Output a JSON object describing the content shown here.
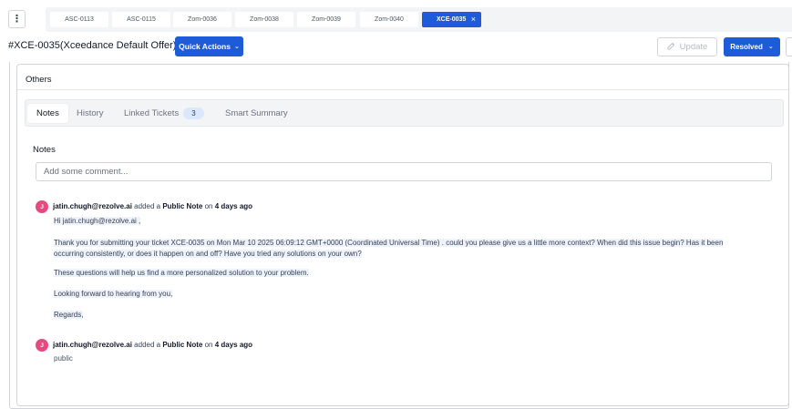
{
  "menu_icon": "vertical-dots-icon",
  "tabs": [
    {
      "label": "ASC-0113"
    },
    {
      "label": "ASC-0115"
    },
    {
      "label": "Zom-0036"
    },
    {
      "label": "Zom-0038"
    },
    {
      "label": "Zom-0039"
    },
    {
      "label": "Zom-0040"
    },
    {
      "label": "XCE-0035",
      "active": true,
      "close": "×"
    }
  ],
  "header": {
    "ticket_title": "#XCE-0035(Xceedance Default Offer)",
    "quick_actions": "Quick Actions",
    "update": "Update",
    "status": "Resolved"
  },
  "panel": {
    "section_title": "Others",
    "tabs": {
      "notes": "Notes",
      "history": "History",
      "linked": "Linked Tickets",
      "linked_count": "3",
      "summary": "Smart Summary"
    },
    "notes_heading": "Notes",
    "comment_placeholder": "Add some comment..."
  },
  "notes": [
    {
      "avatar": "J",
      "author": "jatin.chugh@rezolve.ai",
      "added": "added a",
      "type": "Public Note",
      "on": "on",
      "time": "4 days ago",
      "lines": {
        "greeting": "Hi jatin.chugh@rezolve.ai ,",
        "p1a": "Thank you for submitting your ticket XCE-0035  on Mon Mar 10 2025 06:09:12 GMT+0000 (Coordinated Universal Time) . could you please give us a little more context? When did this issue begin? Has it been",
        "p1b": "occurring consistently, or does it happen on and off? Have you tried any solutions on your own?",
        "p2": "These questions will help us find a more personalized solution to your problem.",
        "p3": "Looking forward to hearing from you,",
        "p4": "Regards,"
      }
    },
    {
      "avatar": "J",
      "author": "jatin.chugh@rezolve.ai",
      "added": "added a",
      "type": "Public Note",
      "on": "on",
      "time": "4 days ago",
      "body": "public"
    }
  ],
  "colors": {
    "primary": "#1d5bd8",
    "avatar": "#e84a7f",
    "badge": "#dbe7fb"
  }
}
